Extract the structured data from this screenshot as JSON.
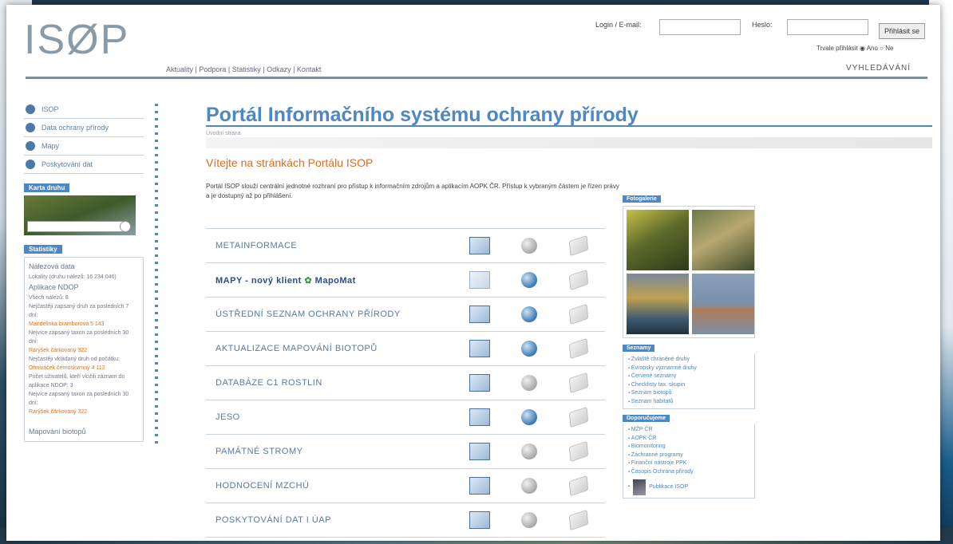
{
  "logo_text": "ISØP",
  "top_nav": "Aktuality | Podpora | Statistiky | Odkazy | Kontakt",
  "login": {
    "email_label": "Login / E-mail:",
    "password_label": "Heslo:",
    "submit": "Přihlásit se",
    "remember": "Trvale přihlásit ◉ Ano ○ Ne",
    "search": "VYHLEDÁVÁNÍ"
  },
  "sidebar": {
    "items": [
      {
        "label": "ISOP"
      },
      {
        "label": "Data ochrany přírody"
      },
      {
        "label": "Mapy"
      },
      {
        "label": "Poskytování dat"
      }
    ],
    "map_header": "Karta druhu",
    "stats_header": "Statistiky",
    "stats": {
      "line1": "Nálezová data",
      "line2": "Lokality (druhu nálezů: 16 234 046)",
      "h2": "Aplikace NDOP",
      "line3": "Všech nálezů: 8",
      "line4": "Nejčastěji zapsaný druh za posledních 7 dní:",
      "line5": "Mandelinka bramborová  5 143",
      "line6": "Nejvíce zapsaný taxon za posledních 30 dní:",
      "line7": "Rarýšek čárkovaný  322",
      "line8": "Nejčastěji vkládaný druh od počátku:",
      "line9": "Ohniváček černoskvrnný  4 112",
      "line10": "Počet uživatelů, kteří vložili záznam do aplikace NDOP: 3",
      "line11": "Nejvíce zapsaný taxon za posledních 30 dní:",
      "line12": "Rarýšek čárkovaný  322",
      "h3": "Mapování biotopů"
    }
  },
  "main": {
    "title": "Portál Informačního systému ochrany přírody",
    "subtitle": "Úvodní strana",
    "welcome": "Vítejte na stránkách Portálu ISOP",
    "intro": "Portál ISOP slouží centrální jednotné rozhraní pro přístup k informačním zdrojům a aplikacím AOPK ČR. Přístup k vybraným částem je řízen právy a je dostupný až po přihlášení.",
    "rows": [
      {
        "label": "METAINFORMACE",
        "bold": false,
        "map_active": true,
        "globe_active": false
      },
      {
        "label": "MAPY - nový klient",
        "extra": "MapoMat",
        "bold": true,
        "map_active": false,
        "globe_active": true
      },
      {
        "label": "ÚSTŘEDNÍ SEZNAM OCHRANY PŘÍRODY",
        "bold": false,
        "map_active": true,
        "globe_active": true
      },
      {
        "label": "AKTUALIZACE MAPOVÁNÍ BIOTOPŮ",
        "bold": false,
        "map_active": true,
        "globe_active": true
      },
      {
        "label": "DATABÁZE C1 ROSTLIN",
        "bold": false,
        "map_active": true,
        "globe_active": false
      },
      {
        "label": "JESO",
        "bold": false,
        "map_active": true,
        "globe_active": true
      },
      {
        "label": "PAMÁTNÉ STROMY",
        "bold": false,
        "map_active": true,
        "globe_active": false
      },
      {
        "label": "HODNOCENÍ MZCHÚ",
        "bold": false,
        "map_active": true,
        "globe_active": false
      },
      {
        "label": "POSKYTOVÁNÍ DAT I ÚAP",
        "bold": false,
        "map_active": true,
        "globe_active": false
      }
    ]
  },
  "right": {
    "photos_header": "Fotogalerie",
    "registry_header": "Seznamy",
    "registry": [
      "Zvláště chráněné druhy",
      "Evropsky významné druhy",
      "Červené seznamy",
      "Checklisty tax. skupin",
      "Seznam biotopů",
      "Seznam habitatů"
    ],
    "links_header": "Doporučujeme",
    "links": [
      "MŽP ČR",
      "AOPK ČR",
      "Biomonitoring",
      "Záchranné programy",
      "Finanční nástroje PPK",
      "Časopis Ochrana přírody"
    ],
    "publication": "Publikace ISOP"
  },
  "colors": {
    "accent": "#4e87c4",
    "orange": "#e06a20"
  }
}
